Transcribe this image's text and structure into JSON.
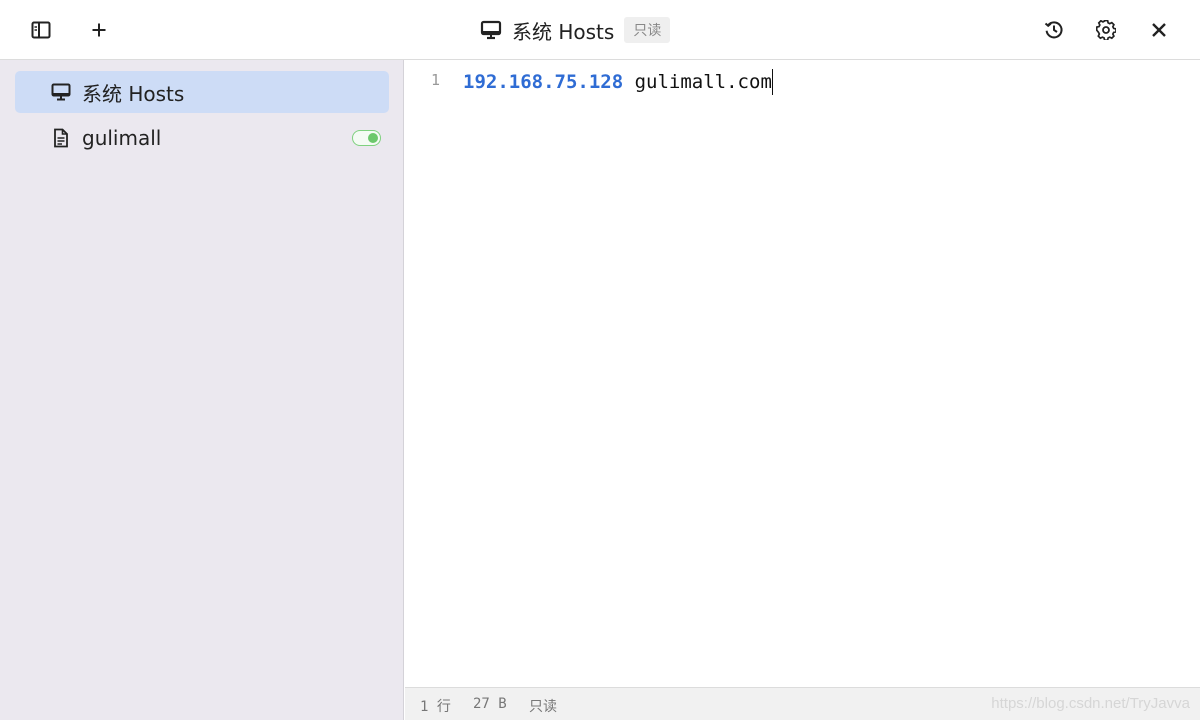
{
  "toolbar": {
    "title": "系统 Hosts",
    "readonly_badge": "只读",
    "icons": {
      "sidebar_toggle": "sidebar-toggle-icon",
      "add": "plus-icon",
      "history": "history-icon",
      "settings": "gear-icon",
      "close": "close-icon",
      "title": "monitor-icon"
    }
  },
  "sidebar": {
    "items": [
      {
        "label": "系统 Hosts",
        "icon": "monitor-icon",
        "active": true
      },
      {
        "label": "gulimall",
        "icon": "document-icon",
        "active": false,
        "enabled": true
      }
    ]
  },
  "editor": {
    "lines": [
      {
        "number": "1",
        "ip": "192.168.75.128",
        "host": "gulimall.com"
      }
    ],
    "colors": {
      "ip": "#2f6cd4"
    }
  },
  "status": {
    "lines": "1 行",
    "size": "27 B",
    "mode": "只读",
    "watermark": "https://blog.csdn.net/TryJavva"
  }
}
